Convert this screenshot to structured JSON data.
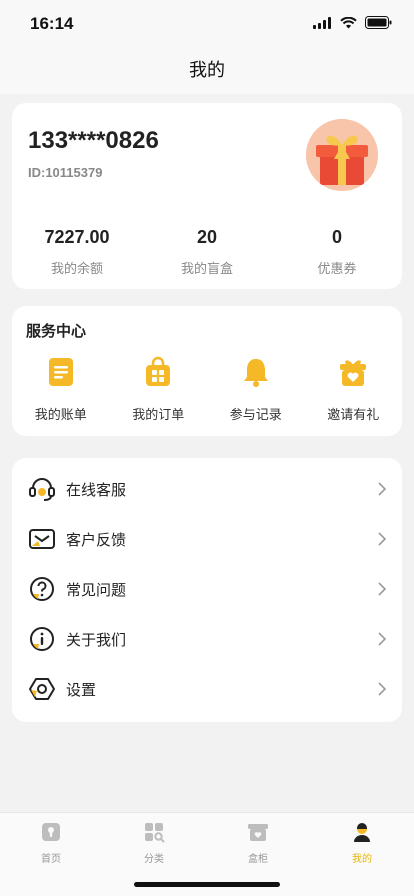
{
  "status_bar": {
    "time": "16:14"
  },
  "header": {
    "title": "我的"
  },
  "profile": {
    "phone": "133****0826",
    "user_id": "ID:10115379",
    "stats": [
      {
        "value": "7227.00",
        "label": "我的余额"
      },
      {
        "value": "20",
        "label": "我的盲盒"
      },
      {
        "value": "0",
        "label": "优惠券"
      }
    ]
  },
  "services": {
    "title": "服务中心",
    "items": [
      {
        "label": "我的账单",
        "icon": "bill-icon"
      },
      {
        "label": "我的订单",
        "icon": "order-bag-icon"
      },
      {
        "label": "参与记录",
        "icon": "bell-icon"
      },
      {
        "label": "邀请有礼",
        "icon": "gift-heart-icon"
      }
    ]
  },
  "menu": {
    "items": [
      {
        "label": "在线客服",
        "icon": "headset-icon"
      },
      {
        "label": "客户反馈",
        "icon": "feedback-mail-icon"
      },
      {
        "label": "常见问题",
        "icon": "question-icon"
      },
      {
        "label": "关于我们",
        "icon": "info-icon"
      },
      {
        "label": "设置",
        "icon": "settings-hexagon-icon"
      }
    ]
  },
  "tabbar": {
    "tabs": [
      {
        "label": "首页",
        "icon": "home-icon",
        "active": false
      },
      {
        "label": "分类",
        "icon": "category-icon",
        "active": false
      },
      {
        "label": "盒柜",
        "icon": "box-cabinet-icon",
        "active": false
      },
      {
        "label": "我的",
        "icon": "profile-icon",
        "active": true
      }
    ]
  },
  "colors": {
    "accent": "#f5b928",
    "active_tab": "#e9b60c",
    "background": "#f2f2f2"
  }
}
